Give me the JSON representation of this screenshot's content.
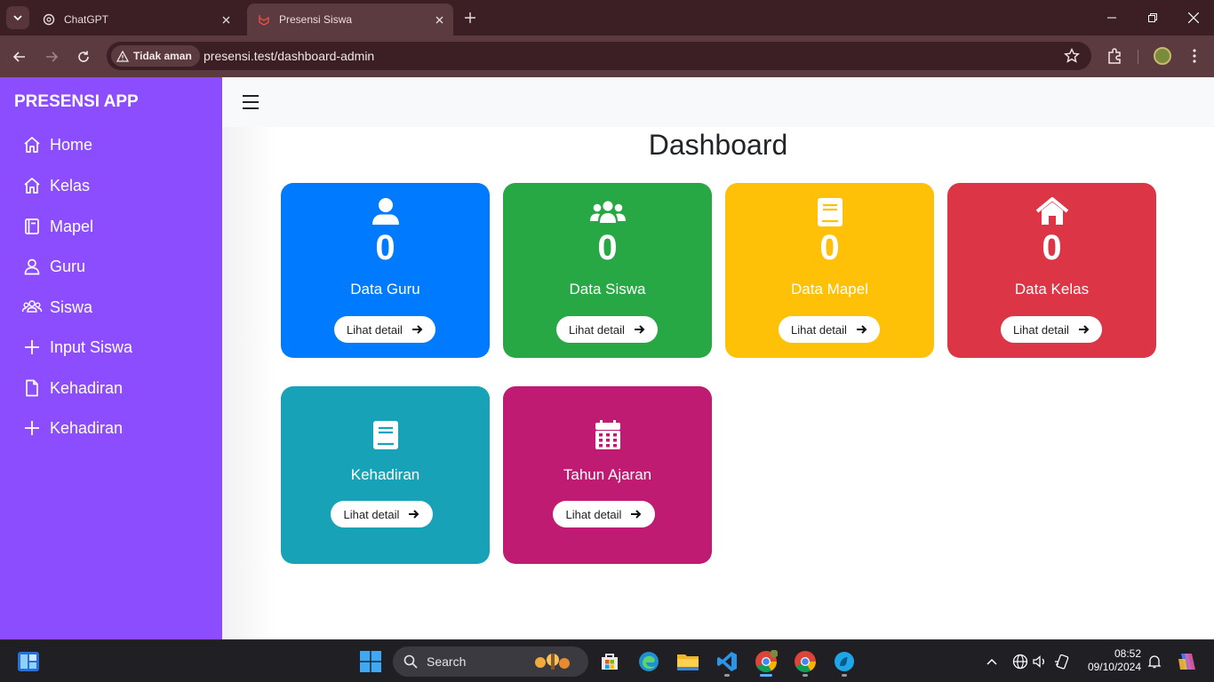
{
  "browser": {
    "tabs": [
      {
        "title": "ChatGPT",
        "icon": "chatgpt-icon"
      },
      {
        "title": "Presensi Siswa",
        "icon": "laravel-icon"
      }
    ],
    "security_label": "Tidak aman",
    "url": "presensi.test/dashboard-admin"
  },
  "sidebar": {
    "brand": "PRESENSI APP",
    "items": [
      {
        "label": "Home",
        "icon": "home-icon"
      },
      {
        "label": "Kelas",
        "icon": "home-icon"
      },
      {
        "label": "Mapel",
        "icon": "book-icon"
      },
      {
        "label": "Guru",
        "icon": "user-icon"
      },
      {
        "label": "Siswa",
        "icon": "users-icon"
      },
      {
        "label": "Input Siswa",
        "icon": "plus-icon"
      },
      {
        "label": "Kehadiran",
        "icon": "file-icon"
      },
      {
        "label": "Kehadiran",
        "icon": "plus-icon"
      }
    ]
  },
  "main": {
    "title": "Dashboard",
    "cards": [
      {
        "label": "Data Guru",
        "count": "0",
        "button": "Lihat detail",
        "icon": "user-icon",
        "color": "#007bff"
      },
      {
        "label": "Data Siswa",
        "count": "0",
        "button": "Lihat detail",
        "icon": "users-icon",
        "color": "#28a745"
      },
      {
        "label": "Data Mapel",
        "count": "0",
        "button": "Lihat detail",
        "icon": "book-icon",
        "color": "#ffc107"
      },
      {
        "label": "Data Kelas",
        "count": "0",
        "button": "Lihat detail",
        "icon": "home-icon",
        "color": "#dc3545"
      },
      {
        "label": "Kehadiran",
        "button": "Lihat detail",
        "icon": "book-icon",
        "color": "#17a2b8"
      },
      {
        "label": "Tahun Ajaran",
        "button": "Lihat detail",
        "icon": "calendar-icon",
        "color": "#bf1b72"
      }
    ]
  },
  "taskbar": {
    "search_label": "Search",
    "time": "08:52",
    "date": "09/10/2024"
  },
  "colors": {
    "sidebar": "#8b4dff",
    "tab_strip": "#3b1f24",
    "toolbar": "#5b3a40"
  }
}
